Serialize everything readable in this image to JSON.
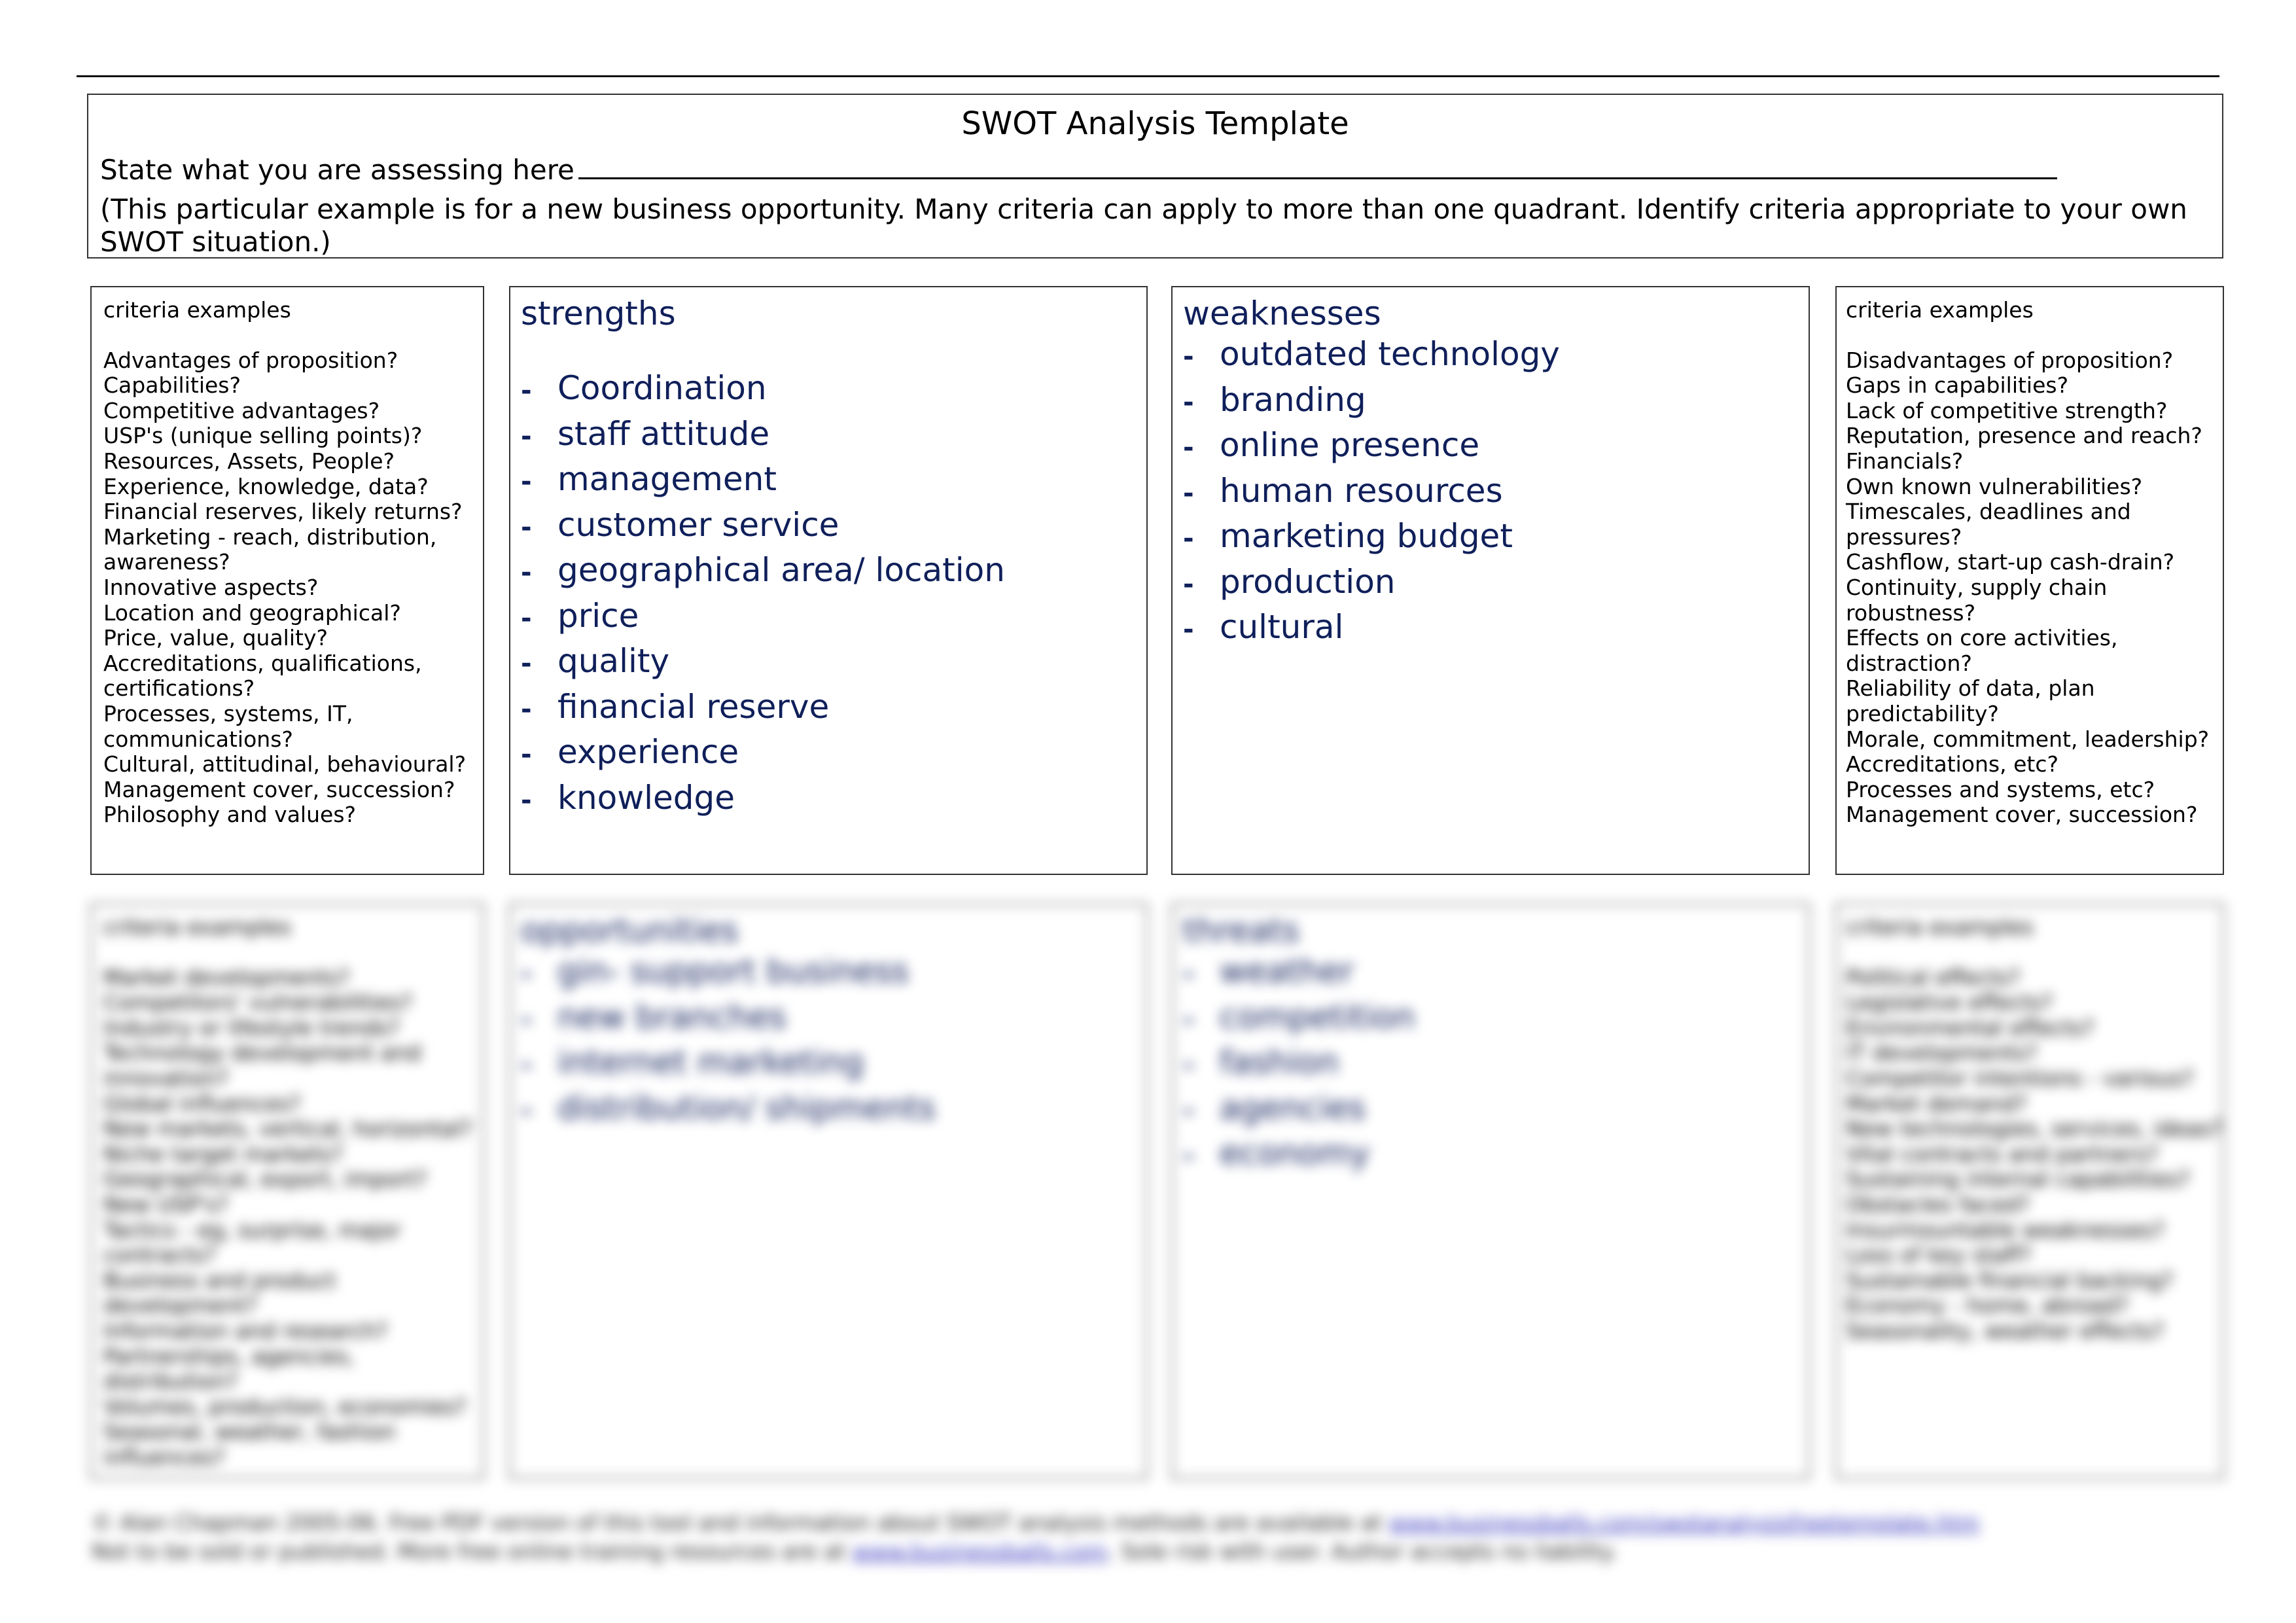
{
  "document": {
    "title": "SWOT Analysis Template",
    "assess_prompt": "State what you are assessing here",
    "note": "(This particular example is for a new business opportunity. Many criteria can apply to more than one quadrant. Identify criteria appropriate to your own SWOT situation.)"
  },
  "top_row": {
    "left_criteria": {
      "title": "criteria examples",
      "items": [
        "Advantages of proposition?",
        "Capabilities?",
        "Competitive advantages?",
        "USP's (unique selling points)?",
        "Resources, Assets, People?",
        "Experience, knowledge, data?",
        "Financial reserves, likely returns?",
        "Marketing - reach, distribution, awareness?",
        "Innovative aspects?",
        "Location and geographical?",
        "Price, value, quality?",
        "Accreditations, qualifications, certifications?",
        "Processes, systems, IT, communications?",
        "Cultural, attitudinal, behavioural?",
        "Management cover, succession?",
        "Philosophy and values?"
      ]
    },
    "strengths": {
      "title": "strengths",
      "items": [
        "Coordination",
        "staff attitude",
        "management",
        "customer service",
        "geographical area/ location",
        "price",
        "quality",
        "financial reserve",
        "experience",
        "knowledge"
      ]
    },
    "weaknesses": {
      "title": "weaknesses",
      "items": [
        "outdated technology",
        "branding",
        "online presence",
        "human resources",
        "marketing budget",
        "production",
        "cultural"
      ]
    },
    "right_criteria": {
      "title": "criteria examples",
      "items": [
        "Disadvantages of proposition?",
        "Gaps in capabilities?",
        "Lack of competitive strength?",
        "Reputation, presence and reach?",
        "Financials?",
        "Own known vulnerabilities?",
        "Timescales, deadlines and pressures?",
        "Cashflow, start-up cash-drain?",
        "Continuity, supply chain robustness?",
        "Effects on core activities, distraction?",
        "Reliability of data, plan predictability?",
        "Morale, commitment, leadership?",
        "Accreditations, etc?",
        "Processes and systems, etc?",
        "Management cover, succession?"
      ]
    }
  },
  "bottom_row": {
    "left_criteria": {
      "title": "criteria examples",
      "items": [
        "Market developments?",
        "Competitors' vulnerabilities?",
        "Industry or lifestyle trends?",
        "Technology development and innovation?",
        "Global influences?",
        "New markets, vertical, horizontal?",
        "Niche target markets?",
        "Geographical, export, import?",
        "New USP's?",
        "Tactics - eg, surprise, major contracts?",
        "Business and product development?",
        "Information and research?",
        "Partnerships, agencies, distribution?",
        "Volumes, production, economies?",
        "Seasonal, weather, fashion influences?"
      ]
    },
    "opportunities": {
      "title": "opportunities",
      "items": [
        "gin- support business",
        "new branches",
        "internet marketing",
        "distribution/ shipments"
      ]
    },
    "threats": {
      "title": "threats",
      "items": [
        "weather",
        "competition",
        "fashion",
        "agencies",
        "economy"
      ]
    },
    "right_criteria": {
      "title": "criteria examples",
      "items": [
        "Political effects?",
        "Legislative effects?",
        "Environmental effects?",
        "IT developments?",
        "Competitor intentions - various?",
        "Market demand?",
        "New technologies, services, ideas?",
        "Vital contracts and partners?",
        "Sustaining internal capabilities?",
        "Obstacles faced?",
        "Insurmountable weaknesses?",
        "Loss of key staff?",
        "Sustainable financial backing?",
        "Economy - home, abroad?",
        "Seasonality, weather effects?"
      ]
    }
  },
  "footer": {
    "line1": "© Alan Chapman 2005-06.  Free PDF version of this tool and information about SWOT analysis methods are available at",
    "link1": "www.businessballs.com/swotanalysisfreetemplate.htm",
    "line2a": "Not to be sold or published. More free online training resources are at",
    "link2": "www.businessballs.com",
    "line2b": ". Sole risk with user. Author accepts no liability."
  },
  "colors": {
    "quadrant_text": "#0f1f5a",
    "border": "#333333",
    "link": "#3b3bbf"
  }
}
